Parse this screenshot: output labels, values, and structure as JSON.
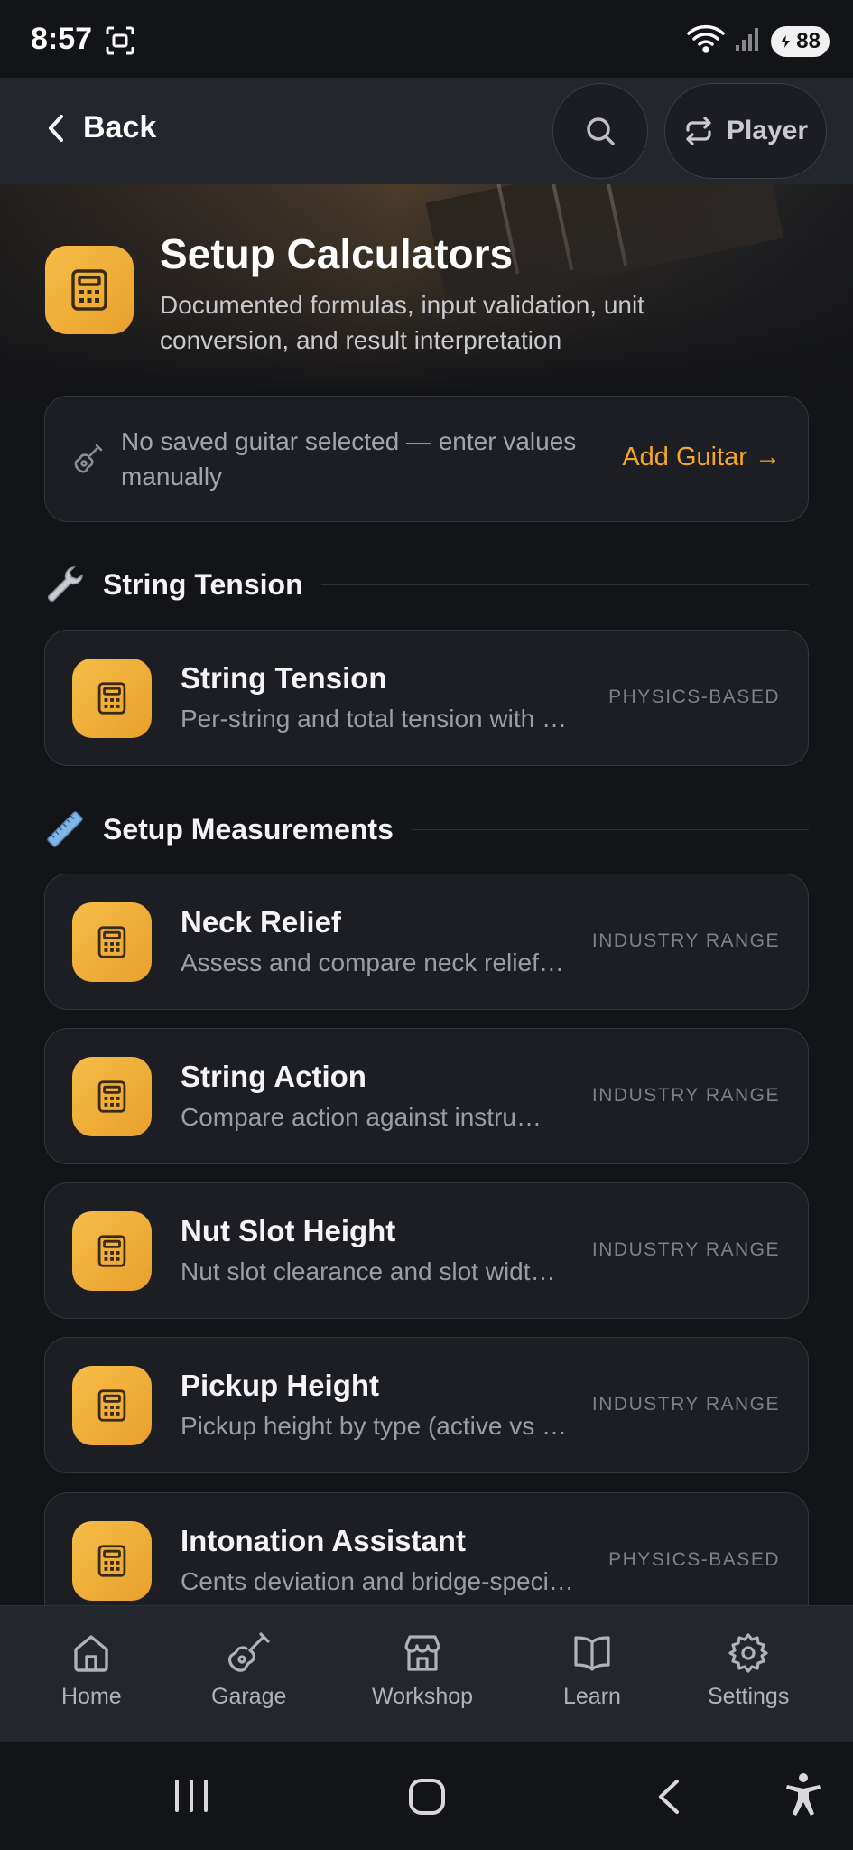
{
  "status": {
    "time": "8:57",
    "battery": "88"
  },
  "header": {
    "back_label": "Back",
    "player_label": "Player"
  },
  "hero": {
    "title": "Setup Calculators",
    "subtitle": "Documented formulas, input validation, unit conversion, and result interpretation"
  },
  "banner": {
    "text": "No saved guitar selected — enter values manually",
    "link": "Add Guitar →"
  },
  "sections": [
    {
      "emoji": "wrench-icon",
      "title": "String Tension"
    },
    {
      "emoji": "ruler-icon",
      "title": "Setup Measurements"
    }
  ],
  "calculators": [
    {
      "title": "String Tension",
      "desc": "Per-string and total tension with …",
      "tag": "PHYSICS-BASED"
    },
    {
      "title": "Neck Relief",
      "desc": "Assess and compare neck relief…",
      "tag": "INDUSTRY RANGE"
    },
    {
      "title": "String Action",
      "desc": "Compare action against instru…",
      "tag": "INDUSTRY RANGE"
    },
    {
      "title": "Nut Slot Height",
      "desc": "Nut slot clearance and slot widt…",
      "tag": "INDUSTRY RANGE"
    },
    {
      "title": "Pickup Height",
      "desc": "Pickup height by type (active vs …",
      "tag": "INDUSTRY RANGE"
    },
    {
      "title": "Intonation Assistant",
      "desc": "Cents deviation and bridge-speci…",
      "tag": "PHYSICS-BASED"
    }
  ],
  "nav": {
    "items": [
      {
        "label": "Home",
        "icon": "home-icon"
      },
      {
        "label": "Garage",
        "icon": "guitar-icon"
      },
      {
        "label": "Workshop",
        "icon": "store-icon"
      },
      {
        "label": "Learn",
        "icon": "book-icon"
      },
      {
        "label": "Settings",
        "icon": "gear-icon"
      }
    ]
  },
  "colors": {
    "accent": "#F3A829",
    "icon_bg": "#F6BD47",
    "card_bg": "#1C1E23",
    "page_bg": "#131418"
  }
}
